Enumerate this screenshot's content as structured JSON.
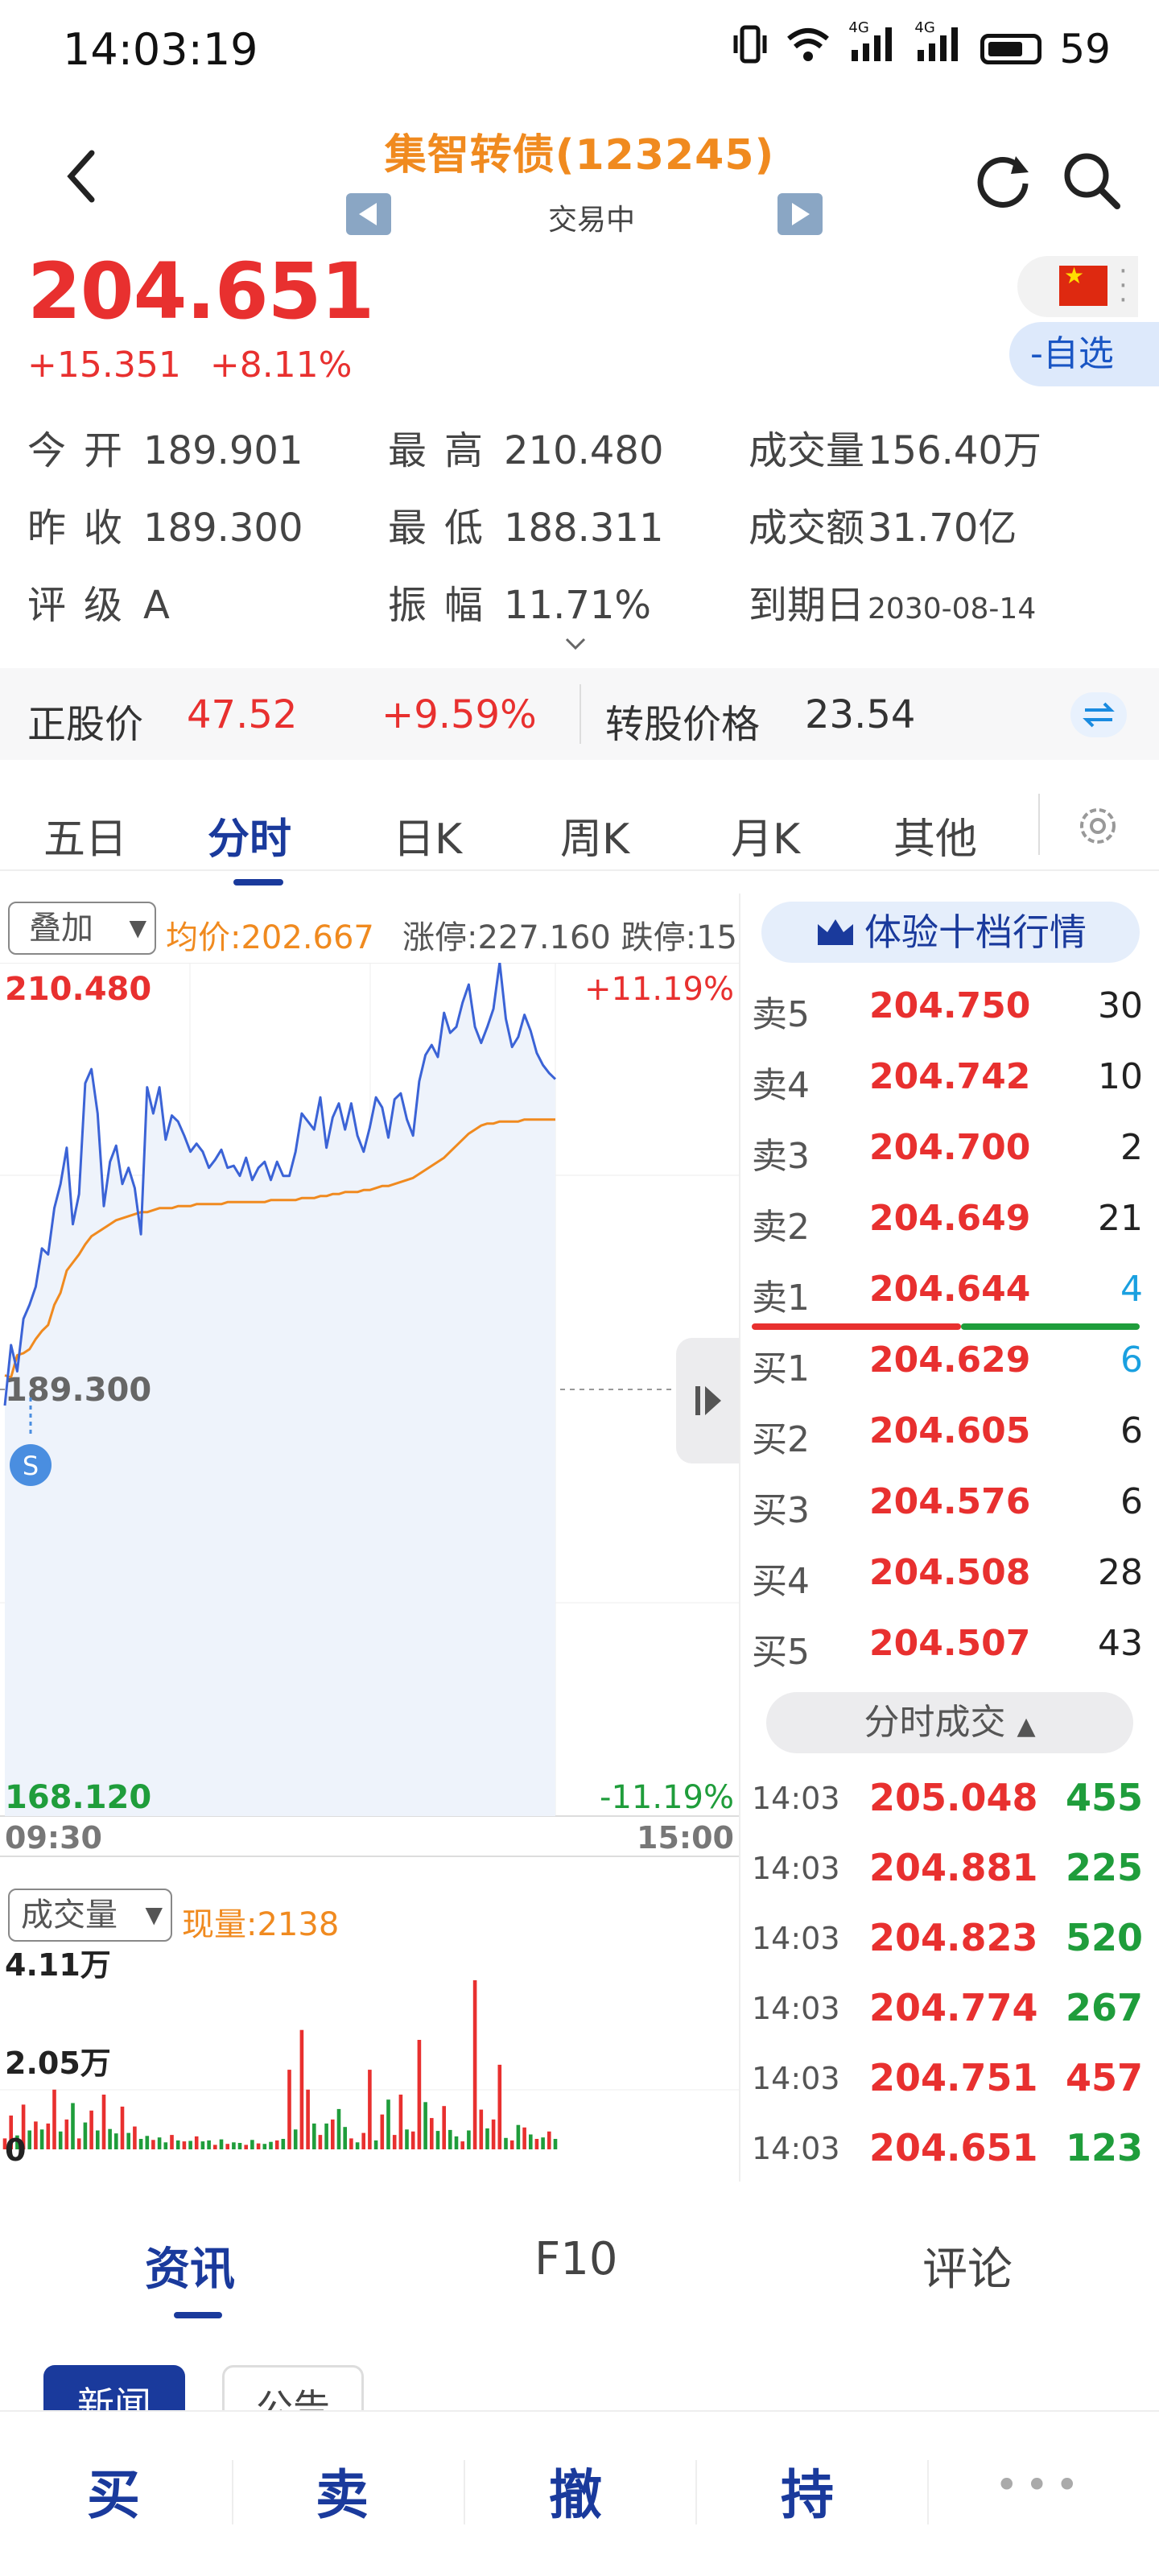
{
  "status_bar": {
    "time": "14:03:19",
    "signal1": "4G",
    "signal2": "4G",
    "battery": "59"
  },
  "header": {
    "title": "集智转债(123245)",
    "trade_state": "交易中"
  },
  "quote": {
    "price": "204.651",
    "change": "+15.351",
    "change_pct": "+8.11%",
    "watch_button": "-自选"
  },
  "stats": {
    "open_label": "今开",
    "open": "189.901",
    "high_label": "最高",
    "high": "210.480",
    "volume_label": "成交量",
    "volume": "156.40万",
    "prev_close_label": "昨收",
    "prev_close": "189.300",
    "low_label": "最低",
    "low": "188.311",
    "amount_label": "成交额",
    "amount": "31.70亿",
    "rating_label": "评级",
    "rating": "A",
    "amplitude_label": "振幅",
    "amplitude": "11.71%",
    "maturity_label": "到期日",
    "maturity": "2030-08-14"
  },
  "stock_bar": {
    "stock_price_label": "正股价",
    "stock_price": "47.52",
    "stock_pct": "+9.59%",
    "conv_label": "转股价格",
    "conv_price": "23.54"
  },
  "chart_tabs": [
    {
      "label": "五日"
    },
    {
      "label": "分时"
    },
    {
      "label": "日K"
    },
    {
      "label": "周K"
    },
    {
      "label": "月K"
    },
    {
      "label": "其他"
    }
  ],
  "chart_controls": {
    "overlay": "叠加",
    "avg_text": "均价:202.667",
    "limit_text": "涨停:227.160  跌停:15",
    "volume_select": "成交量",
    "volume_now": "现量:2138"
  },
  "chart_data": {
    "type": "line",
    "y_max_label": "210.480",
    "y_mid_label": "189.300",
    "y_min_label": "168.120",
    "pct_max_label": "+11.19%",
    "pct_min_label": "-11.19%",
    "x_start": "09:30",
    "x_end": "15:00",
    "ylim": [
      168.12,
      210.48
    ],
    "prev_close": 189.3,
    "series": [
      {
        "values": [
          188.5,
          191.5,
          190.2,
          192.8,
          193.5,
          194.4,
          196.3,
          196.0,
          198.3,
          199.5,
          201.3,
          197.5,
          199.0,
          204.5,
          205.2,
          203.0,
          198.4,
          200.6,
          201.4,
          199.5,
          200.3,
          199.3,
          197.0,
          204.3,
          203.0,
          204.3,
          201.7,
          202.9,
          202.6,
          201.9,
          201.1,
          201.5,
          201.1,
          200.3,
          200.7,
          201.2,
          200.3,
          200.4,
          199.9,
          200.8,
          199.7,
          200.3,
          200.6,
          199.7,
          200.6,
          199.9,
          199.9,
          201.1,
          203.0,
          202.6,
          202.2,
          203.8,
          201.3,
          202.8,
          203.5,
          202.2,
          203.5,
          201.9,
          201.1,
          202.3,
          203.8,
          203.3,
          201.8,
          203.7,
          204.0,
          202.7,
          201.9,
          204.6,
          205.9,
          206.4,
          205.8,
          208.0,
          207.0,
          207.3,
          208.5,
          209.4,
          207.3,
          206.5,
          207.3,
          208.2,
          210.5,
          207.7,
          206.3,
          206.8,
          207.9,
          207.1,
          206.0,
          205.4,
          205.0,
          204.7
        ]
      },
      {
        "values": [
          190.0,
          189.9,
          191.0,
          191.1,
          191.3,
          191.8,
          192.2,
          192.5,
          193.5,
          194.1,
          195.2,
          195.6,
          196.0,
          196.5,
          196.9,
          197.1,
          197.3,
          197.5,
          197.7,
          197.8,
          197.9,
          198.0,
          198.1,
          198.1,
          198.2,
          198.3,
          198.3,
          198.3,
          198.4,
          198.4,
          198.4,
          198.5,
          198.5,
          198.5,
          198.5,
          198.5,
          198.6,
          198.6,
          198.6,
          198.6,
          198.6,
          198.6,
          198.6,
          198.7,
          198.7,
          198.7,
          198.7,
          198.7,
          198.8,
          198.8,
          198.8,
          198.9,
          198.9,
          199.0,
          199.0,
          199.1,
          199.1,
          199.1,
          199.2,
          199.2,
          199.3,
          199.4,
          199.4,
          199.5,
          199.6,
          199.7,
          199.8,
          200.0,
          200.2,
          200.4,
          200.6,
          200.8,
          201.1,
          201.4,
          201.7,
          202.0,
          202.2,
          202.4,
          202.5,
          202.5,
          202.6,
          202.6,
          202.6,
          202.6,
          202.7,
          202.7,
          202.7,
          202.7,
          202.7,
          202.7
        ]
      }
    ],
    "volume": {
      "max_label": "4.11万",
      "mid_label": "2.05万",
      "min_label": "0",
      "ylim": [
        0,
        41100
      ],
      "values": [
        2200,
        6800,
        2800,
        9000,
        3800,
        5600,
        4000,
        5200,
        12000,
        3600,
        6000,
        9300,
        2200,
        5400,
        7800,
        3800,
        11000,
        4100,
        3200,
        8600,
        3300,
        4600,
        2100,
        2700,
        1900,
        2400,
        1400,
        2900,
        1800,
        1600,
        1700,
        2600,
        1600,
        1800,
        900,
        2000,
        1100,
        1400,
        1300,
        900,
        1900,
        1200,
        1100,
        1500,
        1800,
        2100,
        16000,
        4000,
        24000,
        12000,
        5200,
        2900,
        5200,
        6000,
        8100,
        4500,
        2200,
        1400,
        3300,
        16000,
        1800,
        7000,
        10000,
        2900,
        11000,
        4000,
        3600,
        22000,
        9500,
        6300,
        3700,
        8700,
        3900,
        2600,
        1600,
        3800,
        34000,
        8000,
        4200,
        6000,
        17000,
        2300,
        1800,
        4900,
        4400,
        3000,
        2100,
        2400,
        3600,
        2100
      ],
      "directions": [
        1,
        1,
        0,
        1,
        0,
        1,
        0,
        1,
        1,
        0,
        1,
        0,
        1,
        0,
        1,
        0,
        1,
        0,
        0,
        1,
        0,
        1,
        0,
        0,
        1,
        0,
        0,
        1,
        0,
        1,
        0,
        1,
        0,
        0,
        1,
        0,
        1,
        0,
        0,
        1,
        0,
        1,
        0,
        0,
        1,
        0,
        1,
        0,
        1,
        1,
        0,
        1,
        0,
        1,
        0,
        0,
        1,
        0,
        1,
        1,
        0,
        1,
        0,
        1,
        1,
        0,
        1,
        1,
        0,
        1,
        0,
        1,
        0,
        0,
        1,
        0,
        1,
        1,
        0,
        1,
        1,
        0,
        1,
        0,
        1,
        0,
        1,
        0,
        1,
        0
      ]
    }
  },
  "order_book": {
    "header": "体验十档行情",
    "asks": [
      {
        "label": "卖5",
        "price": "204.750",
        "qty": "30"
      },
      {
        "label": "卖4",
        "price": "204.742",
        "qty": "10"
      },
      {
        "label": "卖3",
        "price": "204.700",
        "qty": "2"
      },
      {
        "label": "卖2",
        "price": "204.649",
        "qty": "21"
      },
      {
        "label": "卖1",
        "price": "204.644",
        "qty": "4"
      }
    ],
    "bids": [
      {
        "label": "买1",
        "price": "204.629",
        "qty": "6"
      },
      {
        "label": "买2",
        "price": "204.605",
        "qty": "6"
      },
      {
        "label": "买3",
        "price": "204.576",
        "qty": "6"
      },
      {
        "label": "买4",
        "price": "204.508",
        "qty": "28"
      },
      {
        "label": "买5",
        "price": "204.507",
        "qty": "43"
      }
    ],
    "trades_button": "分时成交",
    "trades": [
      {
        "time": "14:03",
        "price": "205.048",
        "vol": "455",
        "dir": "buy"
      },
      {
        "time": "14:03",
        "price": "204.881",
        "vol": "225",
        "dir": "buy"
      },
      {
        "time": "14:03",
        "price": "204.823",
        "vol": "520",
        "dir": "buy"
      },
      {
        "time": "14:03",
        "price": "204.774",
        "vol": "267",
        "dir": "buy"
      },
      {
        "time": "14:03",
        "price": "204.751",
        "vol": "457",
        "dir": "sell"
      },
      {
        "time": "14:03",
        "price": "204.651",
        "vol": "123",
        "dir": "buy"
      }
    ]
  },
  "news_tabs": [
    {
      "label": "资讯"
    },
    {
      "label": "F10"
    },
    {
      "label": "评论"
    }
  ],
  "news_subtabs": [
    {
      "label": "新闻"
    },
    {
      "label": "公告"
    }
  ],
  "actions": [
    {
      "label": "买"
    },
    {
      "label": "卖"
    },
    {
      "label": "撤"
    },
    {
      "label": "持"
    }
  ],
  "colors": {
    "up": "#e8302f",
    "down": "#1f9d3b",
    "brand": "#1a3a9c",
    "accent": "#f08a1f",
    "price_line": "#3b63d6"
  }
}
